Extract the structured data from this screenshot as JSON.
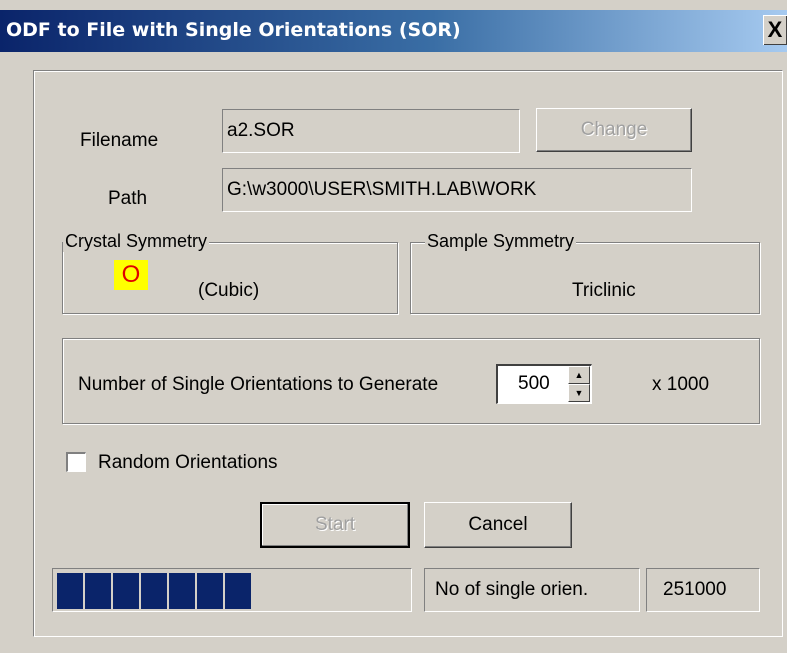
{
  "window": {
    "title": "ODF to File with Single Orientations (SOR)",
    "close_glyph": "X"
  },
  "file": {
    "filename_label": "Filename",
    "filename_value": "a2.SOR",
    "change_label": "Change",
    "path_label": "Path",
    "path_value": "G:\\w3000\\USER\\SMITH.LAB\\WORK"
  },
  "crystal_symmetry": {
    "legend": "Crystal Symmetry",
    "badge": "O",
    "value": "(Cubic)",
    "badge_color": "#ffff00",
    "badge_text_color": "#e00000"
  },
  "sample_symmetry": {
    "legend": "Sample Symmetry",
    "value": "Triclinic"
  },
  "generate": {
    "label": "Number of Single Orientations to Generate",
    "value": "500",
    "multiplier": "x 1000"
  },
  "random": {
    "label": "Random Orientations",
    "checked": false
  },
  "buttons": {
    "start_label": "Start",
    "cancel_label": "Cancel"
  },
  "status": {
    "progress_segments_filled": 7,
    "progress_color": "#0a246a",
    "count_label": "No of single orien.",
    "count_value": "251000"
  }
}
